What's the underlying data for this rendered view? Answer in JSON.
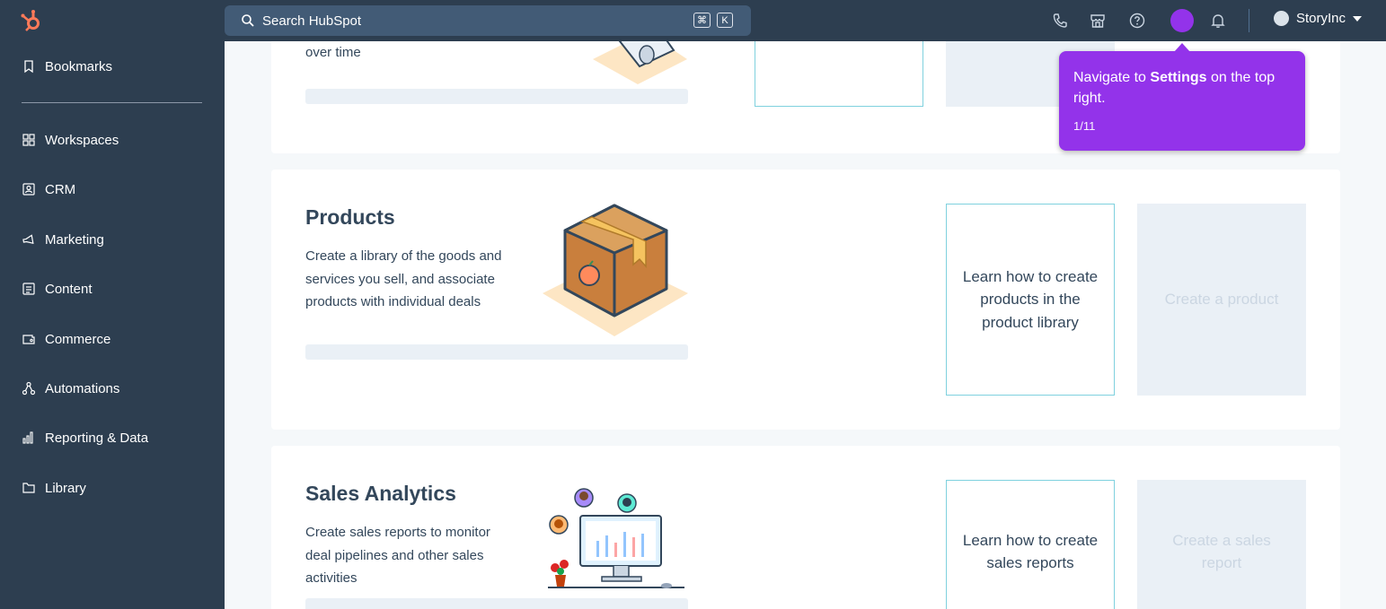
{
  "topbar": {
    "search_placeholder": "Search HubSpot",
    "shortcut_cmd": "⌘",
    "shortcut_key": "K",
    "account_name": "StoryInc",
    "colors": {
      "bg": "#2d3e50",
      "search_bg": "#425b76",
      "accent": "#ff7a59",
      "avatar": "#9333ea"
    }
  },
  "sidebar": {
    "items": [
      {
        "label": "Bookmarks",
        "icon": "bookmark-icon"
      },
      {
        "label": "Workspaces",
        "icon": "grid-icon"
      },
      {
        "label": "CRM",
        "icon": "contact-card-icon"
      },
      {
        "label": "Marketing",
        "icon": "megaphone-icon"
      },
      {
        "label": "Content",
        "icon": "document-icon"
      },
      {
        "label": "Commerce",
        "icon": "wallet-icon"
      },
      {
        "label": "Automations",
        "icon": "workflow-icon"
      },
      {
        "label": "Reporting & Data",
        "icon": "bar-chart-icon"
      },
      {
        "label": "Library",
        "icon": "folder-icon"
      }
    ]
  },
  "cards": {
    "top": {
      "desc_tail": "over time"
    },
    "products": {
      "title": "Products",
      "description": "Create a library of the goods and services you sell, and associate products with individual deals",
      "learn_label": "Learn how to create products in the product library",
      "action_label": "Create a product"
    },
    "sales_analytics": {
      "title": "Sales Analytics",
      "description": "Create sales reports to monitor deal pipelines and other sales activities",
      "learn_label": "Learn how to create sales reports",
      "action_label": "Create a sales report"
    }
  },
  "tooltip": {
    "text_before": "Navigate to ",
    "text_bold": "Settings",
    "text_after": " on the top right.",
    "step": "1/11"
  }
}
